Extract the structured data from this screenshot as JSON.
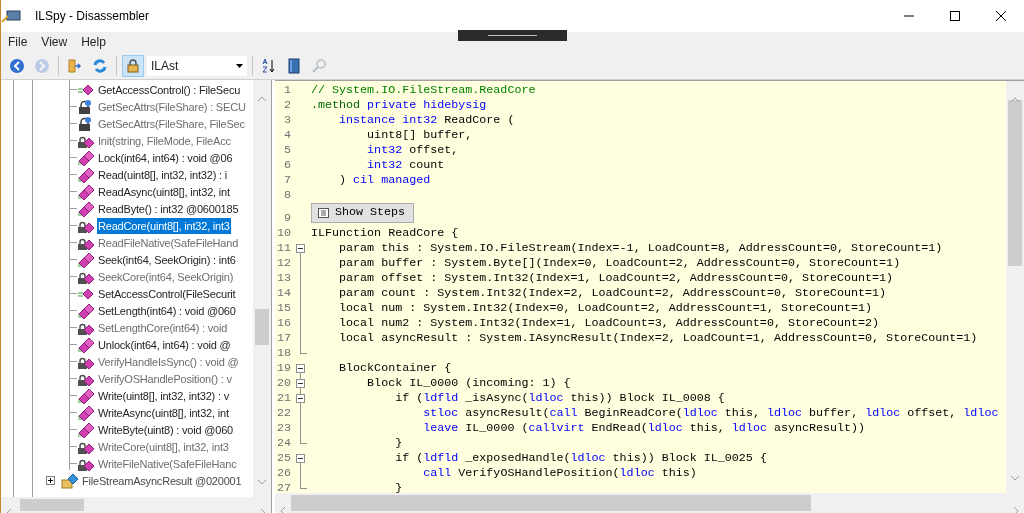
{
  "window": {
    "title": "ILSpy - Disassembler"
  },
  "menu": [
    "File",
    "View",
    "Help"
  ],
  "toolbar": {
    "buttons": [
      {
        "kind": "back",
        "disabled": false,
        "selected": false
      },
      {
        "kind": "forward",
        "disabled": true,
        "selected": false
      },
      {
        "kind": "sep"
      },
      {
        "kind": "open",
        "disabled": false,
        "selected": false
      },
      {
        "kind": "reload",
        "disabled": false,
        "selected": false
      },
      {
        "kind": "sep"
      },
      {
        "kind": "lock",
        "disabled": false,
        "selected": true
      },
      {
        "kind": "combo",
        "value": "ILAst"
      },
      {
        "kind": "sep"
      },
      {
        "kind": "sort",
        "disabled": false,
        "selected": false
      },
      {
        "kind": "book",
        "disabled": false,
        "selected": false
      },
      {
        "kind": "search",
        "disabled": true,
        "selected": false
      }
    ]
  },
  "tree": {
    "members": [
      {
        "kind": "extension",
        "label": "GetAccessControl() : FileSecu",
        "dimmed": false,
        "selected": false
      },
      {
        "kind": "security",
        "label": "GetSecAttrs(FileShare) : SECU",
        "dimmed": true,
        "selected": false
      },
      {
        "kind": "security",
        "label": "GetSecAttrs(FileShare, FileSec",
        "dimmed": true,
        "selected": false
      },
      {
        "kind": "private",
        "label": "Init(string, FileMode, FileAcc",
        "dimmed": true,
        "selected": false
      },
      {
        "kind": "public",
        "label": "Lock(int64, int64) : void @06",
        "dimmed": false,
        "selected": false
      },
      {
        "kind": "public",
        "label": "Read(uint8[], int32, int32) : i",
        "dimmed": false,
        "selected": false
      },
      {
        "kind": "public",
        "label": "ReadAsync(uint8[], int32, int",
        "dimmed": false,
        "selected": false
      },
      {
        "kind": "public",
        "label": "ReadByte() : int32 @0600185",
        "dimmed": false,
        "selected": false
      },
      {
        "kind": "private",
        "label": "ReadCore(uint8[], int32, int3",
        "dimmed": false,
        "selected": true
      },
      {
        "kind": "private",
        "label": "ReadFileNative(SafeFileHand",
        "dimmed": true,
        "selected": false
      },
      {
        "kind": "public",
        "label": "Seek(int64, SeekOrigin) : int6",
        "dimmed": false,
        "selected": false
      },
      {
        "kind": "private",
        "label": "SeekCore(int64, SeekOrigin)",
        "dimmed": true,
        "selected": false
      },
      {
        "kind": "extension",
        "label": "SetAccessControl(FileSecurit",
        "dimmed": false,
        "selected": false
      },
      {
        "kind": "public",
        "label": "SetLength(int64) : void @060",
        "dimmed": false,
        "selected": false
      },
      {
        "kind": "private",
        "label": "SetLengthCore(int64) : void",
        "dimmed": true,
        "selected": false
      },
      {
        "kind": "public",
        "label": "Unlock(int64, int64) : void @",
        "dimmed": false,
        "selected": false
      },
      {
        "kind": "private",
        "label": "VerifyHandleIsSync() : void @",
        "dimmed": true,
        "selected": false
      },
      {
        "kind": "private",
        "label": "VerifyOSHandlePosition() : v",
        "dimmed": true,
        "selected": false
      },
      {
        "kind": "public",
        "label": "Write(uint8[], int32, int32) : v",
        "dimmed": false,
        "selected": false
      },
      {
        "kind": "public",
        "label": "WriteAsync(uint8[], int32, int",
        "dimmed": false,
        "selected": false
      },
      {
        "kind": "public",
        "label": "WriteByte(uint8) : void @060",
        "dimmed": false,
        "selected": false
      },
      {
        "kind": "private",
        "label": "WriteCore(uint8[], int32, int3",
        "dimmed": true,
        "selected": false
      },
      {
        "kind": "private",
        "label": "WriteFileNative(SafeFileHanc",
        "dimmed": true,
        "selected": false
      }
    ],
    "classes": [
      {
        "label": "FileStreamAsyncResult @020001",
        "expanded": false
      }
    ]
  },
  "code": {
    "lines": [
      {
        "num": "1",
        "kind": "plain",
        "segments": [
          {
            "kind": "comment",
            "text": "// System.IO.FileStream.ReadCore"
          }
        ]
      },
      {
        "num": "2",
        "kind": "plain",
        "segments": [
          {
            "kind": "directive",
            "text": ".method"
          },
          {
            "kind": "keyword",
            "text": " private hidebysig"
          }
        ]
      },
      {
        "num": "3",
        "kind": "plain",
        "segments": [
          {
            "kind": "keyword",
            "text": "    instance int32"
          },
          {
            "kind": "plain",
            "text": " ReadCore ("
          }
        ]
      },
      {
        "num": "4",
        "kind": "plain",
        "segments": [
          {
            "kind": "plain",
            "text": "        uint8[] buffer,"
          }
        ]
      },
      {
        "num": "5",
        "kind": "plain",
        "segments": [
          {
            "kind": "keyword",
            "text": "        int32"
          },
          {
            "kind": "plain",
            "text": " offset,"
          }
        ]
      },
      {
        "num": "6",
        "kind": "plain",
        "segments": [
          {
            "kind": "keyword",
            "text": "        int32"
          },
          {
            "kind": "plain",
            "text": " count"
          }
        ]
      },
      {
        "num": "7",
        "kind": "plain",
        "segments": [
          {
            "kind": "plain",
            "text": "    ) "
          },
          {
            "kind": "keyword",
            "text": "cil managed"
          }
        ]
      },
      {
        "num": "8",
        "kind": "plain"
      },
      {
        "num": "9",
        "kind": "plain",
        "button": "Show Steps"
      },
      {
        "num": "10",
        "kind": "plain",
        "segments": [
          {
            "kind": "plain",
            "text": "ILFunction ReadCore {"
          }
        ]
      },
      {
        "num": "11",
        "kind": "fold-start",
        "segments": [
          {
            "kind": "plain",
            "text": "    param this : System.IO.FileStream(Index=-1, LoadCount=8, AddressCount=0, StoreCount=1)"
          }
        ]
      },
      {
        "num": "12",
        "kind": "fold-inner",
        "segments": [
          {
            "kind": "plain",
            "text": "    param buffer : System.Byte[](Index=0, LoadCount=2, AddressCount=0, StoreCount=1)"
          }
        ]
      },
      {
        "num": "13",
        "kind": "fold-inner",
        "segments": [
          {
            "kind": "plain",
            "text": "    param offset : System.Int32(Index=1, LoadCount=2, AddressCount=0, StoreCount=1)"
          }
        ]
      },
      {
        "num": "14",
        "kind": "fold-inner",
        "segments": [
          {
            "kind": "plain",
            "text": "    param count : System.Int32(Index=2, LoadCount=2, AddressCount=0, StoreCount=1)"
          }
        ]
      },
      {
        "num": "15",
        "kind": "fold-inner",
        "segments": [
          {
            "kind": "plain",
            "text": "    local num : System.Int32(Index=0, LoadCount=2, AddressCount=1, StoreCount=1)"
          }
        ]
      },
      {
        "num": "16",
        "kind": "fold-inner",
        "segments": [
          {
            "kind": "plain",
            "text": "    local num2 : System.Int32(Index=1, LoadCount=3, AddressCount=0, StoreCount=2)"
          }
        ]
      },
      {
        "num": "17",
        "kind": "fold-inner",
        "segments": [
          {
            "kind": "plain",
            "text": "    local asyncResult : System.IAsyncResult(Index=2, LoadCount=1, AddressCount=0, StoreCount=1)"
          }
        ]
      },
      {
        "num": "18",
        "kind": "fold-end"
      },
      {
        "num": "19",
        "kind": "fold-start",
        "segments": [
          {
            "kind": "plain",
            "text": "    BlockContainer {"
          }
        ]
      },
      {
        "num": "20",
        "kind": "fold-start",
        "segments": [
          {
            "kind": "plain",
            "text": "        Block IL_0000 (incoming: 1) {"
          }
        ]
      },
      {
        "num": "21",
        "kind": "fold-start",
        "segments": [
          {
            "kind": "plain",
            "text": "            if ("
          },
          {
            "kind": "keyword",
            "text": "ldfld"
          },
          {
            "kind": "plain",
            "text": " _isAsync("
          },
          {
            "kind": "keyword",
            "text": "ldloc"
          },
          {
            "kind": "plain",
            "text": " this)) Block IL_0008 {"
          }
        ]
      },
      {
        "num": "22",
        "kind": "fold-inner",
        "segments": [
          {
            "kind": "keyword",
            "text": "                stloc"
          },
          {
            "kind": "plain",
            "text": " asyncResult("
          },
          {
            "kind": "keyword",
            "text": "call"
          },
          {
            "kind": "plain",
            "text": " BeginReadCore("
          },
          {
            "kind": "keyword",
            "text": "ldloc"
          },
          {
            "kind": "plain",
            "text": " this, "
          },
          {
            "kind": "keyword",
            "text": "ldloc"
          },
          {
            "kind": "plain",
            "text": " buffer, "
          },
          {
            "kind": "keyword",
            "text": "ldloc"
          },
          {
            "kind": "plain",
            "text": " offset, "
          },
          {
            "kind": "keyword",
            "text": "ldloc"
          }
        ]
      },
      {
        "num": "23",
        "kind": "fold-inner",
        "segments": [
          {
            "kind": "keyword",
            "text": "                leave"
          },
          {
            "kind": "plain",
            "text": " IL_0000 ("
          },
          {
            "kind": "keyword",
            "text": "callvirt"
          },
          {
            "kind": "plain",
            "text": " EndRead("
          },
          {
            "kind": "keyword",
            "text": "ldloc"
          },
          {
            "kind": "plain",
            "text": " this, "
          },
          {
            "kind": "keyword",
            "text": "ldloc"
          },
          {
            "kind": "plain",
            "text": " asyncResult))"
          }
        ]
      },
      {
        "num": "24",
        "kind": "fold-end",
        "segments": [
          {
            "kind": "plain",
            "text": "            }"
          }
        ]
      },
      {
        "num": "25",
        "kind": "fold-start",
        "segments": [
          {
            "kind": "plain",
            "text": "            if ("
          },
          {
            "kind": "keyword",
            "text": "ldfld"
          },
          {
            "kind": "plain",
            "text": " _exposedHandle("
          },
          {
            "kind": "keyword",
            "text": "ldloc"
          },
          {
            "kind": "plain",
            "text": " this)) Block IL_0025 {"
          }
        ]
      },
      {
        "num": "26",
        "kind": "fold-inner",
        "segments": [
          {
            "kind": "keyword",
            "text": "                call"
          },
          {
            "kind": "plain",
            "text": " VerifyOSHandlePosition("
          },
          {
            "kind": "keyword",
            "text": "ldloc"
          },
          {
            "kind": "plain",
            "text": " this)"
          }
        ]
      },
      {
        "num": "27",
        "kind": "fold-end",
        "segments": [
          {
            "kind": "plain",
            "text": "            }"
          }
        ]
      }
    ]
  }
}
